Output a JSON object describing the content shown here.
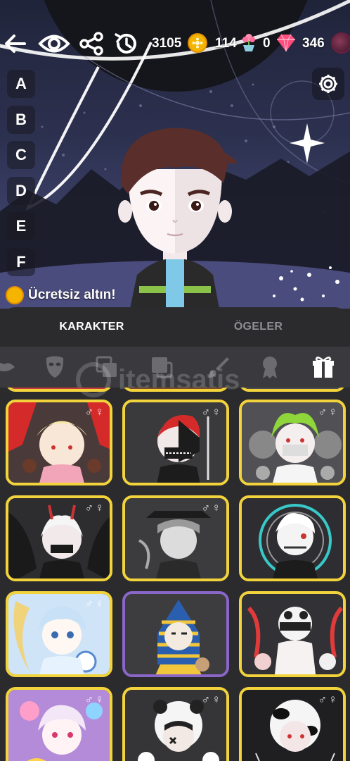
{
  "topbar": {
    "coins": "3105",
    "flowers": "114",
    "potions": "0",
    "gems": "346"
  },
  "letters": [
    "A",
    "B",
    "C",
    "D",
    "E",
    "F"
  ],
  "free_gold_label": "Ücretsiz altın!",
  "tabs": {
    "character": "KARAKTER",
    "items": "ÖGELER"
  },
  "watermark": "itemsatis",
  "gender_symbol": "♂♀",
  "colors": {
    "card_border_gold": "#f2d33b",
    "card_border_purple": "#8a66c9",
    "panel_bg": "#2b2b2e",
    "category_bar": "#3a3a3e",
    "gem": "#ff4d7e",
    "coin": "#f4b400"
  },
  "icons": [
    "back-arrow-icon",
    "eye-icon",
    "share-icon",
    "history-icon",
    "coin-icon",
    "flower-pot-icon",
    "gem-icon",
    "orb-icon",
    "gear-icon",
    "lips-icon",
    "mask-icon",
    "layers-icon",
    "square-icon",
    "brush-icon",
    "badge-icon",
    "gift-icon"
  ]
}
